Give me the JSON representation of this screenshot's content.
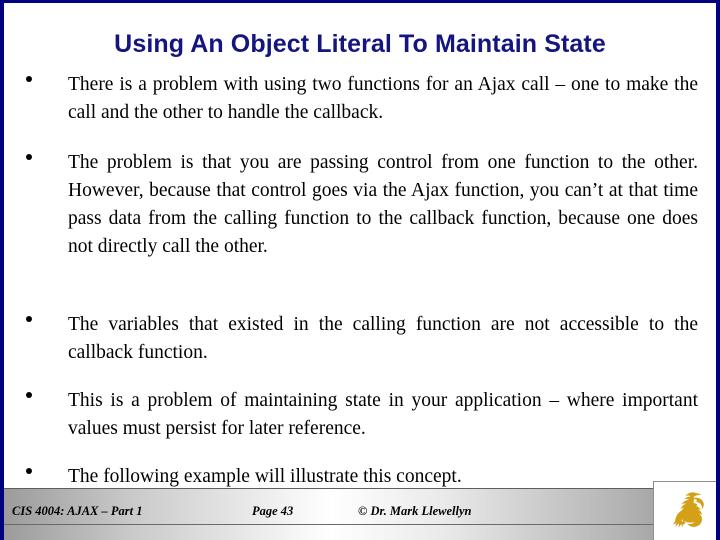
{
  "slide": {
    "title": "Using An Object Literal To Maintain State",
    "title_color": "#15157f",
    "border_color": "#000080",
    "background_color": "#ffffff",
    "body_text_color": "#000000"
  },
  "body": {
    "bullet_glyph": "•",
    "bullets": [
      {
        "text": "There is a problem with using two functions for an Ajax call – one to make the call and the other to handle the callback."
      },
      {
        "text": "The problem is that you are passing control from one function to the other.   However, because that control goes via the Ajax function, you can’t at that time pass data from the calling function to the callback function, because one does not directly call the other."
      },
      {
        "text": "The variables that existed in the calling function are not accessible to the callback function."
      },
      {
        "text": "This is a problem of maintaining state in your application – where important values must persist for later reference."
      },
      {
        "text": "The following example will illustrate this concept."
      }
    ]
  },
  "footer": {
    "course": "CIS 4004: AJAX – Part 1",
    "page": "Page 43",
    "copyright": "© Dr. Mark Llewellyn",
    "logo_name": "ucf-pegasus-logo",
    "logo_color": "#d4a017"
  }
}
